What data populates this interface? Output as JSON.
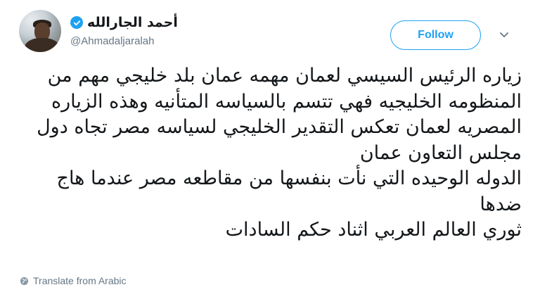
{
  "author": {
    "display_name": "أحمد الجارالله",
    "handle": "@Ahmadaljaralah",
    "verified": true
  },
  "follow_label": "Follow",
  "tweet": {
    "lines": [
      "زياره الرئيس السيسي لعمان مهمه عمان بلد خليجي مهم من",
      "المنظومه الخليجيه فهي تتسم بالسياسه المتأنيه وهذه الزياره",
      "المصريه لعمان تعكس التقدير الخليجي لسياسه مصر تجاه دول",
      "مجلس التعاون عمان",
      "الدوله الوحيده التي نأت بنفسها من مقاطعه مصر عندما هاج",
      "ضدها",
      "ثوري العالم العربي اثناد حكم السادات"
    ]
  },
  "translate_label": "Translate from Arabic",
  "colors": {
    "accent": "#1da1f2",
    "muted": "#657786",
    "text": "#14171a"
  },
  "icons": {
    "verified": "verified-badge-icon",
    "caret": "chevron-down-icon",
    "globe": "globe-icon"
  }
}
